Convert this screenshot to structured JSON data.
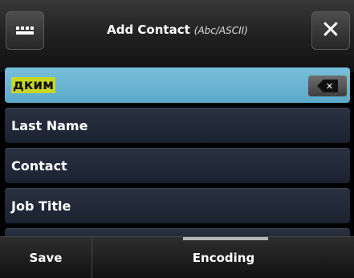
{
  "header": {
    "keyboard_icon": "keyboard-icon",
    "title": "Add Contact",
    "subtitle": "(Abc/ASCII)",
    "close_icon": "close-icon"
  },
  "fields": [
    {
      "value": "дким",
      "active": true,
      "clear_icon": "backspace-icon"
    },
    {
      "placeholder": "Last Name"
    },
    {
      "placeholder": "Contact"
    },
    {
      "placeholder": "Job Title"
    }
  ],
  "softkeys": {
    "save": "Save",
    "encoding": "Encoding"
  },
  "colors": {
    "active_field": "#6fb8d6",
    "highlight": "#c8d624",
    "row_bg": "#222a3a"
  }
}
